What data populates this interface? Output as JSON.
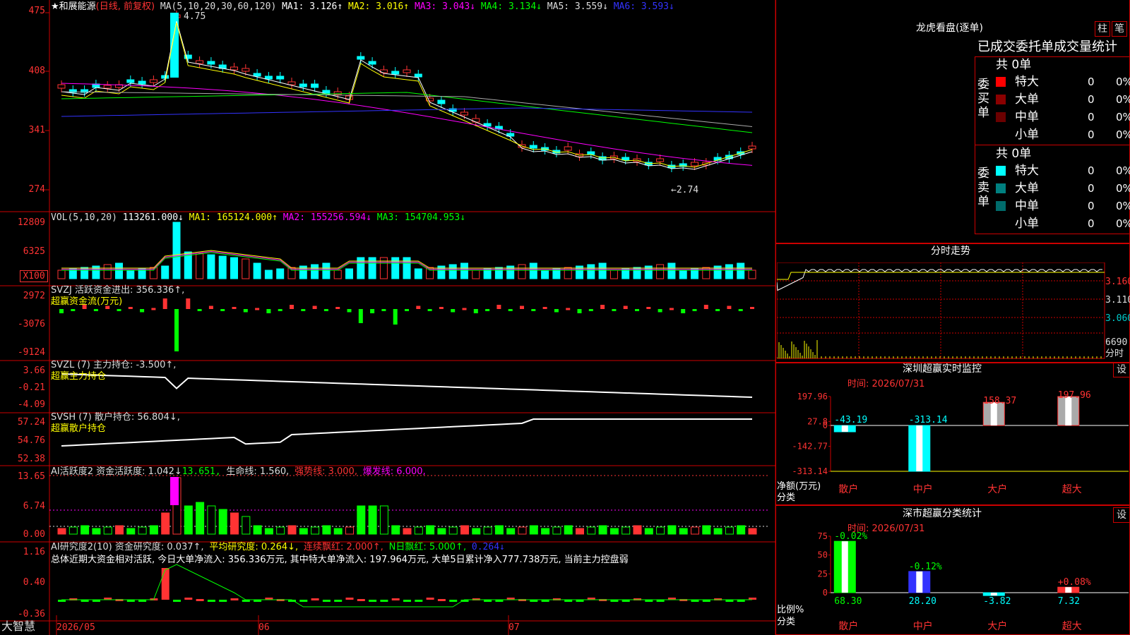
{
  "app": {
    "name": "大智慧"
  },
  "main": {
    "title": "★和展能源",
    "period": "(日线, 前复权)",
    "ma_label": "MA(5,10,20,30,60,120)",
    "ma_values": [
      "MA1: 3.126↑",
      "MA2: 3.016↑",
      "MA3: 3.043↓",
      "MA4: 3.134↓",
      "MA5: 3.559↓",
      "MA6: 3.593↓"
    ],
    "y_ticks": [
      "475",
      "408",
      "341",
      "274"
    ],
    "high_mark": "4.75",
    "low_mark": "←2.74"
  },
  "volume": {
    "label": "VOL(5,10,20)",
    "value": "113261.000↓",
    "ma1": "MA1: 165124.000↑",
    "ma2": "MA2: 155256.594↓",
    "ma3": "MA3: 154704.953↓",
    "y_ticks": [
      "12809",
      "6325",
      "X100"
    ]
  },
  "svzj": {
    "label": "SVZJ  活跃资金进出: 356.336↑,",
    "sub": "超赢资金流(万元)",
    "y_ticks": [
      "2972",
      "-3076",
      "-9124"
    ]
  },
  "svzl": {
    "label": "SVZL (7) 主力持仓: -3.500↑,",
    "sub": "超赢主力持仓",
    "y_ticks": [
      "3.66",
      "-0.21",
      "-4.09"
    ]
  },
  "svsh": {
    "label": "SVSH (7) 散户持仓: 56.804↓,",
    "sub": "超赢散户持仓",
    "y_ticks": [
      "57.24",
      "54.76",
      "52.38"
    ]
  },
  "ai1": {
    "label": "AI活跃度2 资金活跃度: 1.042↓",
    "v2": "13.651,",
    "v3": "生命线: 1.560,",
    "v4": "强势线: 3.000,",
    "v5": "爆发线: 6.000,",
    "y_ticks": [
      "13.65",
      "6.74",
      "0.00"
    ]
  },
  "ai2": {
    "label": "AI研究度2(10) 资金研究度: 0.037↑,",
    "v2": "平均研究度: 0.264↓,",
    "v3": "连续飘红: 2.000↑,",
    "v4": "N日飘红: 5.000↑,",
    "v5": "0.264↓",
    "summary": "总体近期大资金相对活跃, 今日大单净流入: 356.336万元, 其中特大单净流入: 197.964万元, 大单5日累计净入777.738万元, 当前主力控盘弱",
    "y_ticks": [
      "1.16",
      "0.40",
      "-0.36"
    ]
  },
  "x_axis": [
    "2026/05",
    "06",
    "07"
  ],
  "dragon": {
    "title": "龙虎看盘(逐单)",
    "btn_a": "柱",
    "btn_b": "笔",
    "header": "已成交委托单成交量统计",
    "buy_label": "委买单",
    "sell_label": "委卖单",
    "buy_total": "共 0单",
    "sell_total": "共 0单",
    "rows_buy": [
      {
        "name": "特大",
        "count": "0",
        "pct": "0%",
        "color": "#ff0000"
      },
      {
        "name": "大单",
        "count": "0",
        "pct": "0%",
        "color": "#8b0000"
      },
      {
        "name": "中单",
        "count": "0",
        "pct": "0%",
        "color": "#6b0000"
      },
      {
        "name": "小单",
        "count": "0",
        "pct": "0%",
        "color": ""
      }
    ],
    "rows_sell": [
      {
        "name": "特大",
        "count": "0",
        "pct": "0%",
        "color": "#00ffff"
      },
      {
        "name": "大单",
        "count": "0",
        "pct": "0%",
        "color": "#008080"
      },
      {
        "name": "中单",
        "count": "0",
        "pct": "0%",
        "color": "#006b6b"
      },
      {
        "name": "小单",
        "count": "0",
        "pct": "0%",
        "color": ""
      }
    ]
  },
  "intraday": {
    "title": "分时走势",
    "p1": "3.160",
    "p2": "3.110",
    "p3": "3.060",
    "vol": "6690",
    "vol_label": "分时"
  },
  "sz_monitor": {
    "title": "深圳超赢实时监控",
    "btn": "设",
    "time": "时间: 2026/07/31",
    "y_ticks": [
      "197.96",
      "27.8",
      "0",
      "-142.77",
      "-313.14"
    ],
    "ylabel": "净额(万元)",
    "xlabel": "分类",
    "categories": [
      "散户",
      "中户",
      "大户",
      "超大"
    ],
    "values": [
      -43.19,
      -313.14,
      158.37,
      197.96
    ],
    "value_labels": [
      "-43.19",
      "-313.14",
      "158.37",
      "197.96"
    ]
  },
  "sz_class": {
    "title": "深市超赢分类统计",
    "btn": "设",
    "time": "时间: 2026/07/31",
    "y_ticks": [
      "75",
      "50",
      "25",
      "0"
    ],
    "ylabel": "比例%",
    "xlabel": "分类",
    "categories": [
      "散户",
      "中户",
      "大户",
      "超大"
    ],
    "values": [
      68.3,
      28.2,
      -3.82,
      7.32
    ],
    "changes": [
      "-0.02%",
      "-0.12%",
      "",
      "+0.08%"
    ]
  },
  "chart_data": [
    {
      "type": "bar",
      "title": "深圳超赢实时监控",
      "categories": [
        "散户",
        "中户",
        "大户",
        "超大"
      ],
      "values": [
        -43.19,
        -313.14,
        158.37,
        197.96
      ],
      "ylabel": "净额(万元)",
      "xlabel": "分类",
      "ylim": [
        -313.14,
        197.96
      ]
    },
    {
      "type": "bar",
      "title": "深市超赢分类统计",
      "categories": [
        "散户",
        "中户",
        "大户",
        "超大"
      ],
      "values": [
        68.3,
        28.2,
        -3.82,
        7.32
      ],
      "ylabel": "比例%",
      "xlabel": "分类",
      "ylim": [
        0,
        75
      ]
    },
    {
      "type": "line",
      "title": "和展能源 日线",
      "ylim": [
        2.74,
        4.75
      ],
      "x": [
        "2026/05",
        "06",
        "07"
      ]
    }
  ]
}
